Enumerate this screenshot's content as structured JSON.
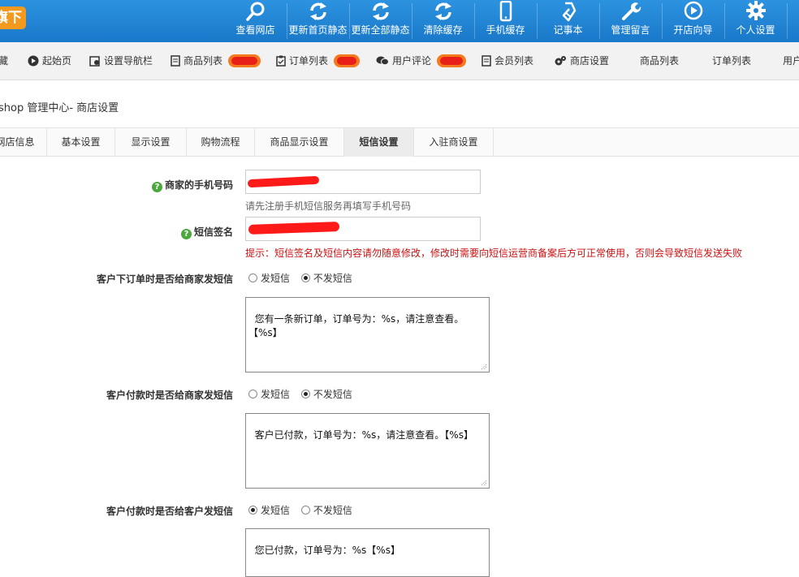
{
  "header": {
    "logo_text": "旗下",
    "items": [
      {
        "label": "查看网店",
        "icon": "search-icon"
      },
      {
        "label": "更新首页静态",
        "icon": "refresh-icon"
      },
      {
        "label": "更新全部静态",
        "icon": "refresh-icon"
      },
      {
        "label": "清除缓存",
        "icon": "refresh-icon"
      },
      {
        "label": "手机缓存",
        "icon": "phone-icon"
      },
      {
        "label": "记事本",
        "icon": "notebook-icon"
      },
      {
        "label": "管理留言",
        "icon": "wrench-icon"
      },
      {
        "label": "开店向导",
        "icon": "play-circle-icon"
      },
      {
        "label": "个人设置",
        "icon": "gear-icon"
      }
    ]
  },
  "nav": {
    "items": [
      {
        "label": "藏",
        "icon": ""
      },
      {
        "label": "起始页",
        "icon": "play-icon"
      },
      {
        "label": "设置导航栏",
        "icon": "settings-nav-icon"
      },
      {
        "label": "商品列表",
        "icon": "document-icon"
      },
      {
        "label": "订单列表",
        "icon": "clipboard-icon"
      },
      {
        "label": "用户评论",
        "icon": "comments-icon"
      },
      {
        "label": "会员列表",
        "icon": "document-icon"
      },
      {
        "label": "商店设置",
        "icon": "gears-icon"
      },
      {
        "label": "商品列表",
        "icon": ""
      },
      {
        "label": "订单列表",
        "icon": ""
      },
      {
        "label": "用户",
        "icon": ""
      }
    ]
  },
  "breadcrumb": "shop 管理中心- 商店设置",
  "tabs": [
    {
      "label": "网店信息"
    },
    {
      "label": "基本设置"
    },
    {
      "label": "显示设置"
    },
    {
      "label": "购物流程"
    },
    {
      "label": "商品显示设置"
    },
    {
      "label": "短信设置",
      "active": true
    },
    {
      "label": "入驻商设置"
    }
  ],
  "form": {
    "phone_label": "商家的手机号码",
    "phone_hint": "请先注册手机短信服务再填写手机号码",
    "sign_label": "短信签名",
    "sign_warning": "提示：短信签名及短信内容请勿随意修改，修改时需要向短信运营商备案后方可正常使用，否则会导致短信发送失败",
    "send_option": "发短信",
    "nosend_option": "不发短信",
    "order_label": "客户下订单时是否给商家发短信",
    "order_template": "您有一条新订单，订单号为：%s，请注意查看。【%s】",
    "pay_label": "客户付款时是否给商家发短信",
    "pay_template": "客户已付款，订单号为：%s，请注意查看。【%s】",
    "pay_customer_label": "客户付款时是否给客户发短信",
    "pay_customer_template": "您已付款，订单号为：%s【%s】"
  }
}
